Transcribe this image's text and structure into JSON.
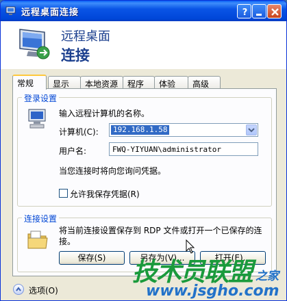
{
  "window": {
    "title": "远程桌面连接",
    "icon": "remote-desktop-icon"
  },
  "banner": {
    "line1": "远程桌面",
    "line2": "连接",
    "icon": "monitor-connection-icon"
  },
  "tabs": [
    {
      "label": "常规"
    },
    {
      "label": "显示"
    },
    {
      "label": "本地资源"
    },
    {
      "label": "程序"
    },
    {
      "label": "体验"
    },
    {
      "label": "高级"
    }
  ],
  "login": {
    "group_title": "登录设置",
    "prompt": "输入远程计算机的名称。",
    "computer_label": "计算机(C):",
    "computer_value": "192.168.1.58",
    "username_label": "用户名:",
    "username_value": "FWQ-YIYUAN\\administrator",
    "credentials_note": "当您连接时将向您询问凭据。",
    "save_credentials_label": "允许我保存凭据(R)",
    "save_credentials_checked": false
  },
  "connection": {
    "group_title": "连接设置",
    "description": "将当前连接设置保存到 RDP 文件或打开一个已保存的连接。",
    "save_label": "保存(S)",
    "save_as_label": "另存为(V)...",
    "open_label": "打开(E)..."
  },
  "footer": {
    "options_label": "选项(O)"
  },
  "watermark": {
    "brand": "技术员联盟",
    "suffix": "之家",
    "url": "www.jsgho.com"
  },
  "colors": {
    "titlebar": "#0054e3",
    "accent_text": "#1b3f8e",
    "group_title": "#0046d5",
    "selection": "#316ac5",
    "watermark_green": "#1a9a3c",
    "watermark_blue": "#2272c9"
  }
}
